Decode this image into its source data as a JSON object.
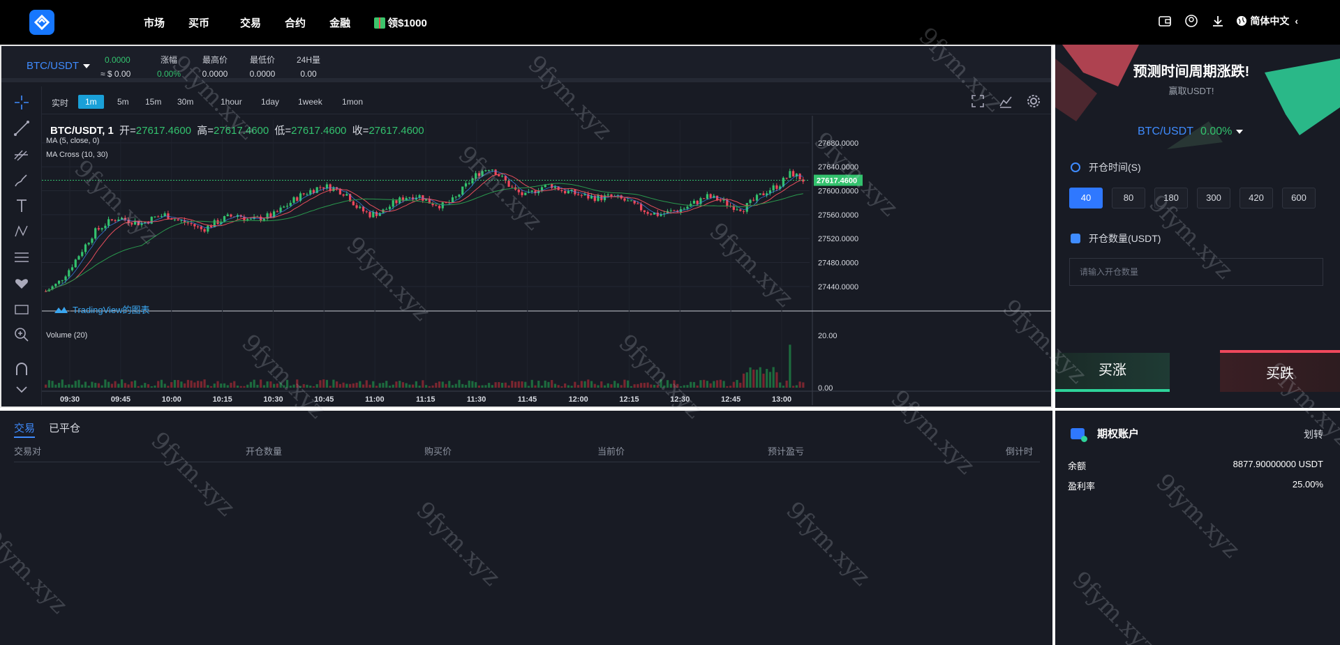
{
  "nav": {
    "items": [
      "市场",
      "买币",
      "交易",
      "合约",
      "金融"
    ],
    "gift_label": "领$1000",
    "language": "简体中文"
  },
  "ticker": {
    "pair": "BTC/USDT",
    "price": "0.0000",
    "price_usd": "≈ $ 0.00",
    "change_label": "涨幅",
    "change_value": "0.00%",
    "high_label": "最高价",
    "high_value": "0.0000",
    "low_label": "最低价",
    "low_value": "0.0000",
    "vol_label": "24H量",
    "vol_value": "0.00"
  },
  "timeframes": [
    "实时",
    "1m",
    "5m",
    "15m",
    "30m",
    "1hour",
    "1day",
    "1week",
    "1mon"
  ],
  "active_timeframe": "1m",
  "chart_legend": {
    "symbol": "BTC/USDT, 1",
    "open_label": "开=",
    "open": "27617.4600",
    "high_label": "高=",
    "high": "27617.4600",
    "low_label": "低=",
    "low": "27617.4600",
    "close_label": "收=",
    "close": "27617.4600",
    "ma": "MA (5, close, 0)",
    "ma_cross": "MA Cross (10, 30)",
    "tradingview": "TradingView的图表",
    "volume": "Volume (20)"
  },
  "chart_data": {
    "type": "candlestick",
    "x_ticks": [
      "09:30",
      "09:45",
      "10:00",
      "10:15",
      "10:30",
      "10:45",
      "11:00",
      "11:15",
      "11:30",
      "11:45",
      "12:00",
      "12:15",
      "12:30",
      "12:45",
      "13:00"
    ],
    "price_ticks": [
      "27680.0000",
      "27640.0000",
      "27600.0000",
      "27560.0000",
      "27520.0000",
      "27480.0000",
      "27440.0000"
    ],
    "volume_ticks": [
      "20.00",
      "0.00"
    ],
    "ylim": [
      27420,
      27695
    ],
    "last_price": "27617.4600",
    "close_path": [
      27432,
      27445,
      27470,
      27500,
      27530,
      27545,
      27555,
      27550,
      27545,
      27555,
      27560,
      27550,
      27545,
      27535,
      27545,
      27555,
      27560,
      27550,
      27555,
      27560,
      27575,
      27590,
      27600,
      27608,
      27604,
      27595,
      27570,
      27560,
      27565,
      27580,
      27590,
      27592,
      27580,
      27575,
      27585,
      27610,
      27630,
      27640,
      27620,
      27600,
      27590,
      27605,
      27610,
      27600,
      27595,
      27590,
      27588,
      27590,
      27585,
      27575,
      27565,
      27560,
      27565,
      27570,
      27580,
      27590,
      27585,
      27575,
      27570,
      27585,
      27600,
      27610,
      27630,
      27618
    ]
  },
  "trade": {
    "title": "预测时间周期涨跌!",
    "subtitle": "赢取USDT!",
    "pair": "BTC/USDT",
    "pct": "0.00%",
    "open_time_label": "开仓时间(S)",
    "times": [
      "40",
      "80",
      "180",
      "300",
      "420",
      "600"
    ],
    "selected_time": "40",
    "qty_label": "开仓数量(USDT)",
    "qty_placeholder": "请输入开仓数量",
    "buy_up": "买涨",
    "buy_down": "买跌"
  },
  "orders": {
    "tabs": [
      "交易",
      "已平仓"
    ],
    "columns": [
      "交易对",
      "开仓数量",
      "购买价",
      "当前价",
      "预计盈亏",
      "倒计时"
    ]
  },
  "account": {
    "title": "期权账户",
    "transfer": "划转",
    "balance_label": "余额",
    "balance_value": "8877.90000000 USDT",
    "profit_label": "盈利率",
    "profit_value": "25.00%"
  },
  "watermark": "9fym.xyz",
  "colors": {
    "up": "#33c26e",
    "down": "#f0485c",
    "accent": "#3f8cff",
    "bg": "#181b24"
  }
}
